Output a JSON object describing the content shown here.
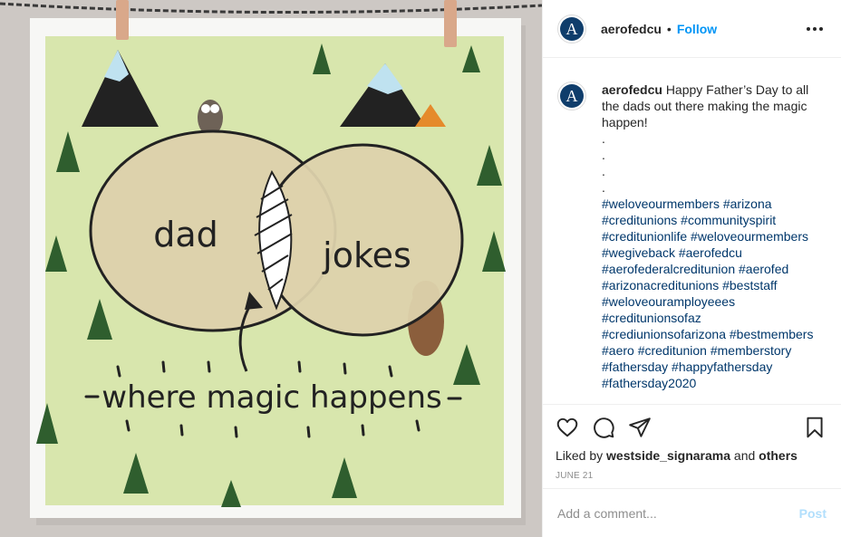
{
  "post": {
    "username": "aerofedcu",
    "dot": "•",
    "follow_label": "Follow",
    "avatar_letter": "A"
  },
  "image": {
    "circle_left_label": "dad",
    "circle_right_label": "jokes",
    "tagline": "where magic happens"
  },
  "caption": {
    "username": "aerofedcu",
    "text": "Happy Father’s Day to all the dads out there making the magic happen!",
    "dots": [
      ".",
      ".",
      ".",
      "."
    ],
    "hashtag_lines": [
      "#weloveourmembers #arizona",
      "#creditunions #communityspirit",
      "#creditunionlife #weloveourmembers",
      "#wegiveback #aerofedcu",
      "#aerofederalcreditunion #aerofed",
      "#arizonacreditunions #beststaff",
      "#weloveouramployeees",
      "#creditunionsofaz",
      "#crediunionsofarizona #bestmembers",
      "#aero #creditunion #memberstory",
      "#fathersday #happyfathersday",
      "#fathersday2020"
    ]
  },
  "likes": {
    "prefix": "Liked by",
    "user": "westside_signarama",
    "middle": "and",
    "others": "others"
  },
  "date": "JUNE 21",
  "comment": {
    "placeholder": "Add a comment...",
    "post_label": "Post"
  },
  "colors": {
    "link_blue": "#0095f6",
    "hashtag": "#00376b",
    "post_disabled": "#b2dffc",
    "avatar_bg": "#0f3d6b",
    "card_green": "#d8e6ad",
    "circle_fill": "#ddd2ac"
  }
}
